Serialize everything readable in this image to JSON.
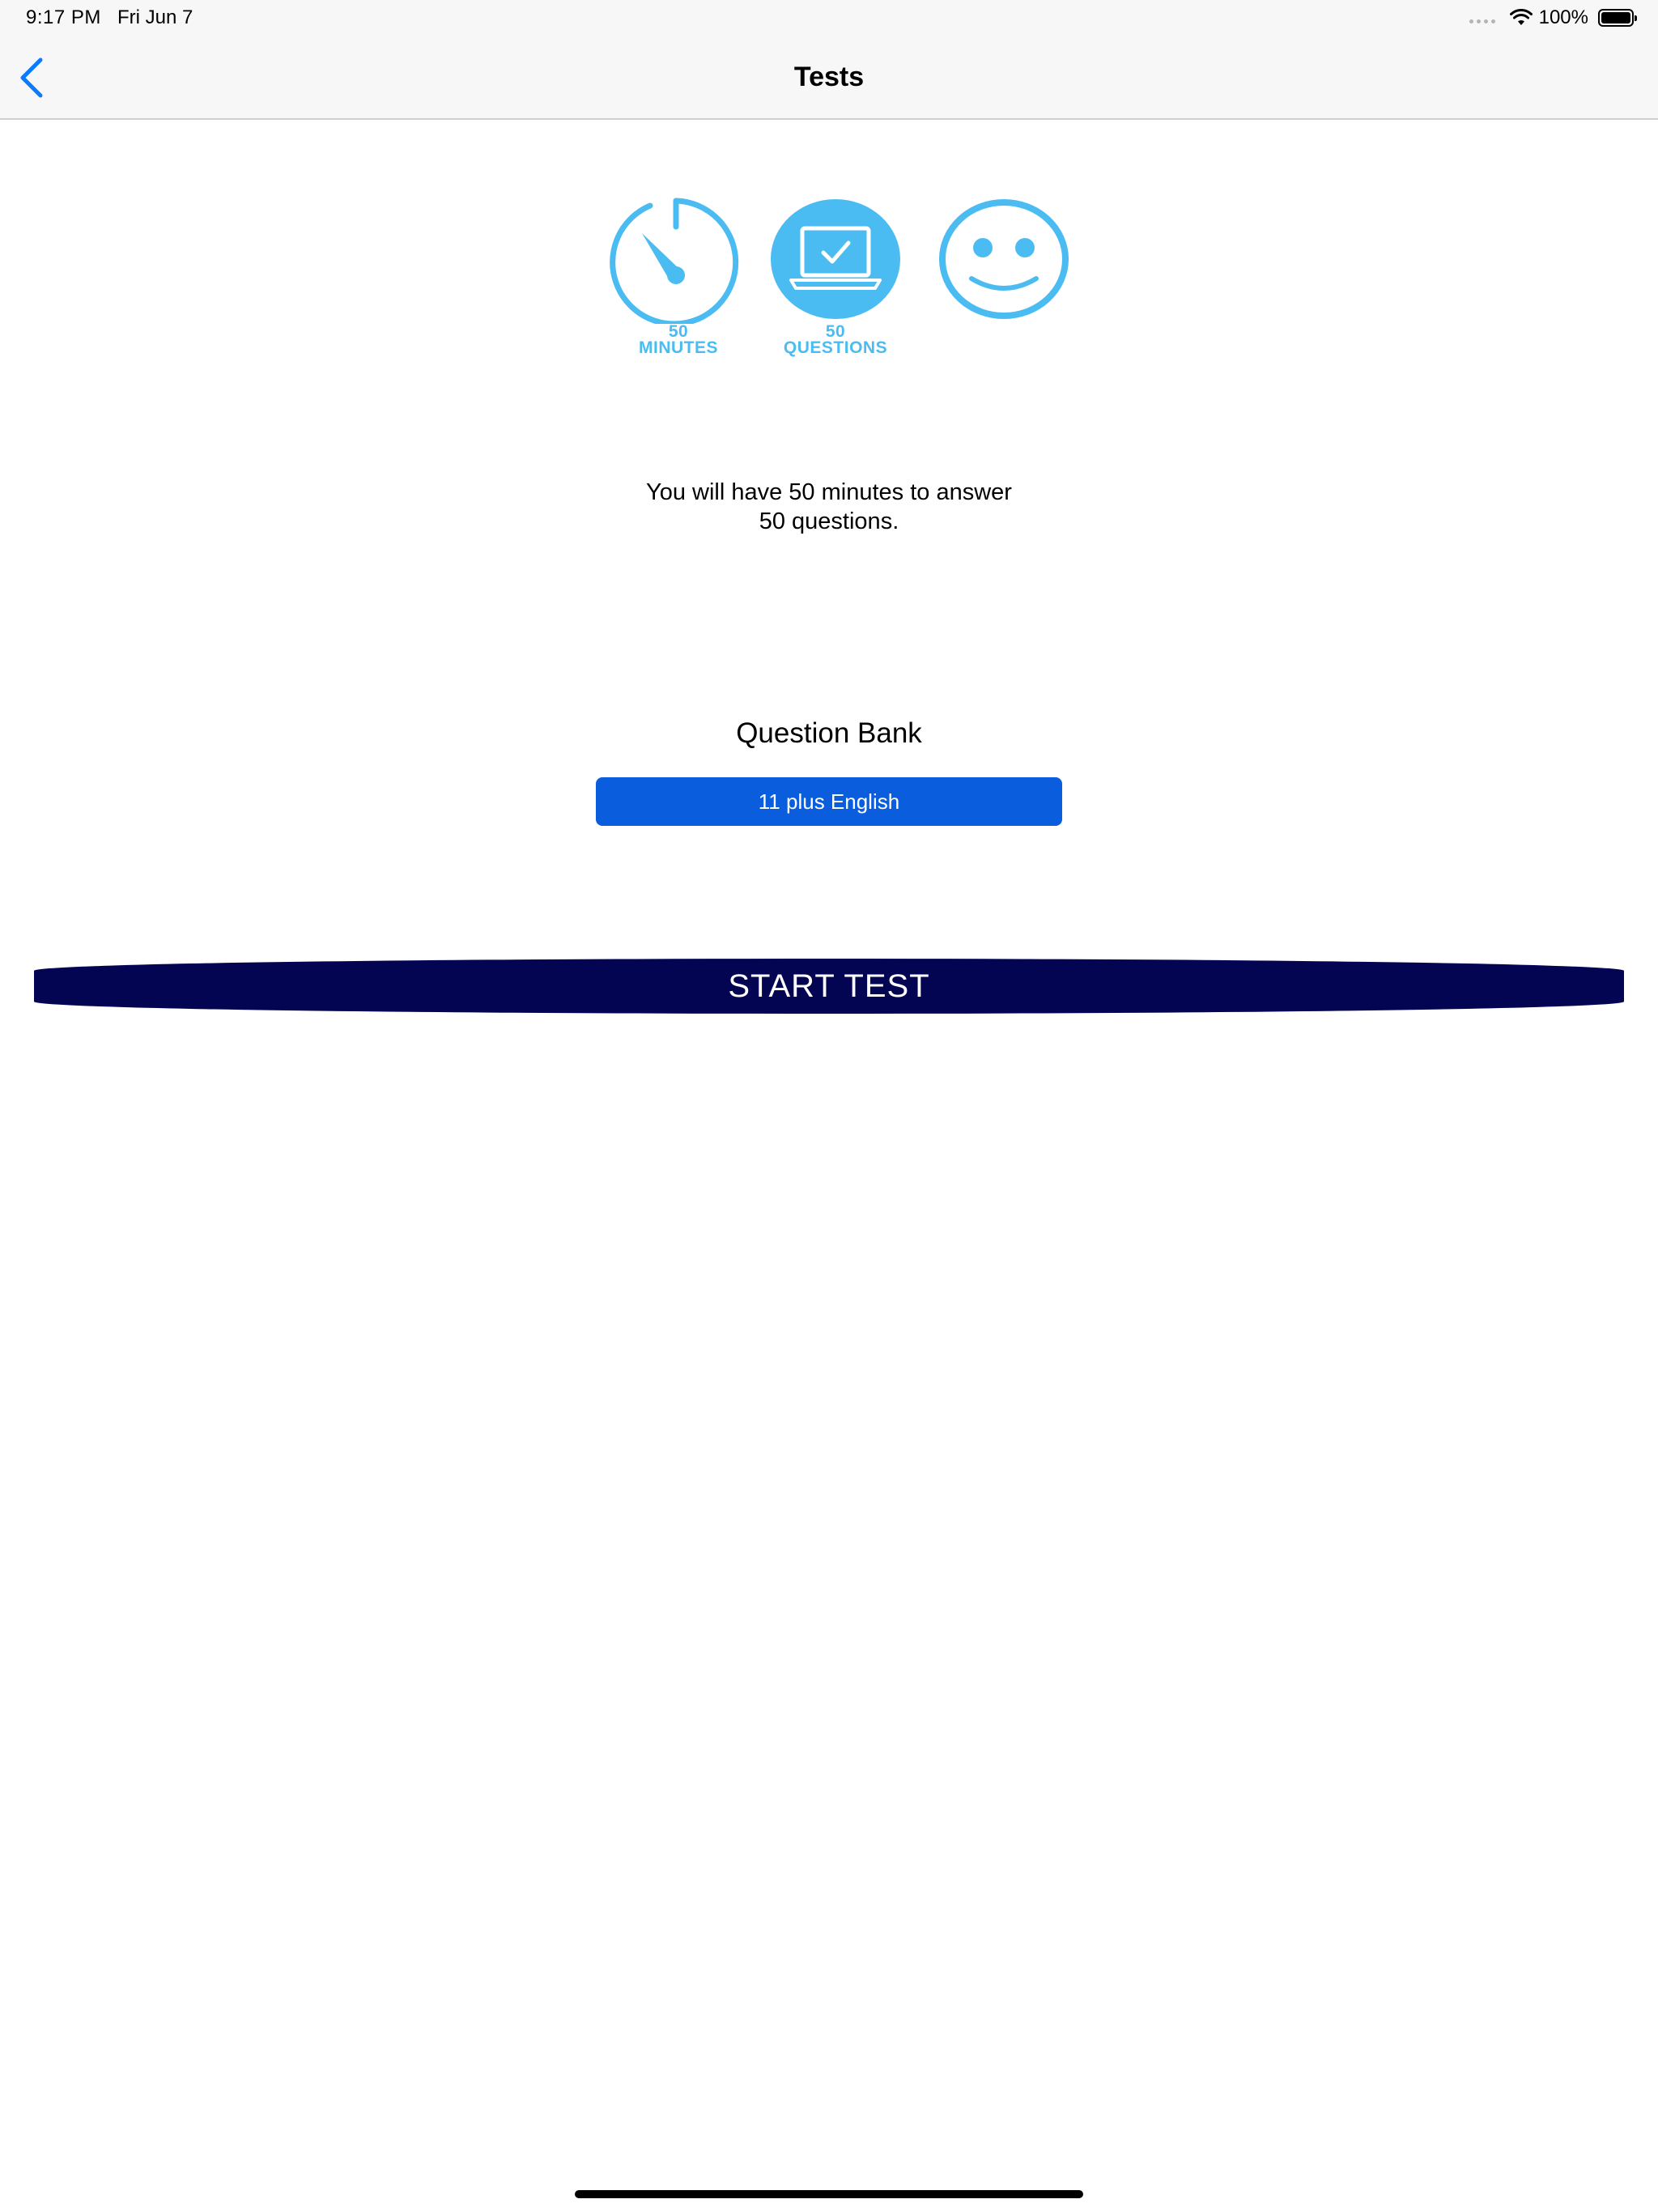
{
  "status_bar": {
    "time": "9:17 PM",
    "date": "Fri Jun 7",
    "battery": "100%"
  },
  "nav": {
    "title": "Tests",
    "back_icon": "chevron-left-icon"
  },
  "icons": {
    "timer": {
      "number": "50",
      "label": "MINUTES",
      "icon": "stopwatch-icon"
    },
    "questions": {
      "number": "50",
      "label": "QUESTIONS",
      "icon": "laptop-check-icon"
    },
    "smiley": {
      "icon": "smiley-face-icon"
    }
  },
  "info": {
    "line1": "You will have 50 minutes to answer",
    "line2": "50 questions."
  },
  "question_bank": {
    "label": "Question Bank",
    "selected": "11 plus English"
  },
  "start_button": "START TEST",
  "colors": {
    "icon_blue": "#4bbcf2",
    "bank_button": "#0a5ede",
    "start_button": "#030553",
    "back_blue": "#0a7aff"
  }
}
